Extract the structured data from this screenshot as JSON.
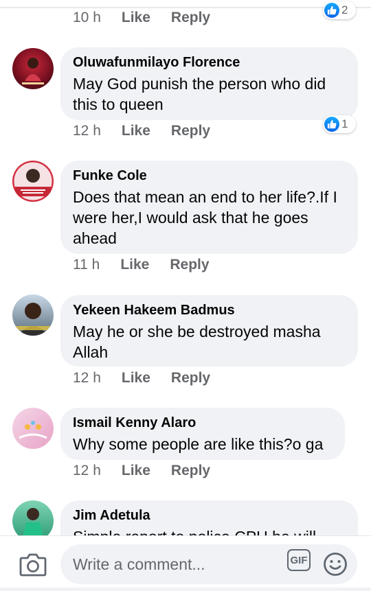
{
  "top_comment": {
    "time": "10 h",
    "like": "Like",
    "reply": "Reply",
    "reaction_count": "2"
  },
  "comments": [
    {
      "author": "Oluwafunmilayo Florence",
      "line1": "May God punish the person who did",
      "line2": "this to queen",
      "line3": "",
      "time": "12 h",
      "like": "Like",
      "reply": "Reply",
      "reaction_count": "1"
    },
    {
      "author": "Funke Cole",
      "line1": "Does that mean an end to her life?.If I",
      "line2": "were her,I would ask that he goes",
      "line3": "ahead",
      "time": "11 h",
      "like": "Like",
      "reply": "Reply"
    },
    {
      "author": "Yekeen Hakeem Badmus",
      "line1": "May he or she be destroyed masha",
      "line2": "Allah",
      "line3": "",
      "time": "12 h",
      "like": "Like",
      "reply": "Reply"
    },
    {
      "author": "Ismail Kenny Alaro",
      "line1": "Why some people are like this?o ga",
      "line2": "",
      "line3": "",
      "time": "12 h",
      "like": "Like",
      "reply": "Reply"
    },
    {
      "author": "Jim Adetula",
      "line1": "Simple report to police CPU he will",
      "line2": "",
      "line3": ""
    }
  ],
  "composer": {
    "placeholder": "Write a comment...",
    "gif_label": "GIF"
  },
  "icons": {
    "camera": "camera-icon",
    "gif": "gif-icon",
    "emoji": "smiley-icon",
    "like": "thumbs-up-icon"
  },
  "colors": {
    "bubble": "#f0f2f5",
    "meta": "#65676b",
    "like_blue": "#1877f2"
  }
}
